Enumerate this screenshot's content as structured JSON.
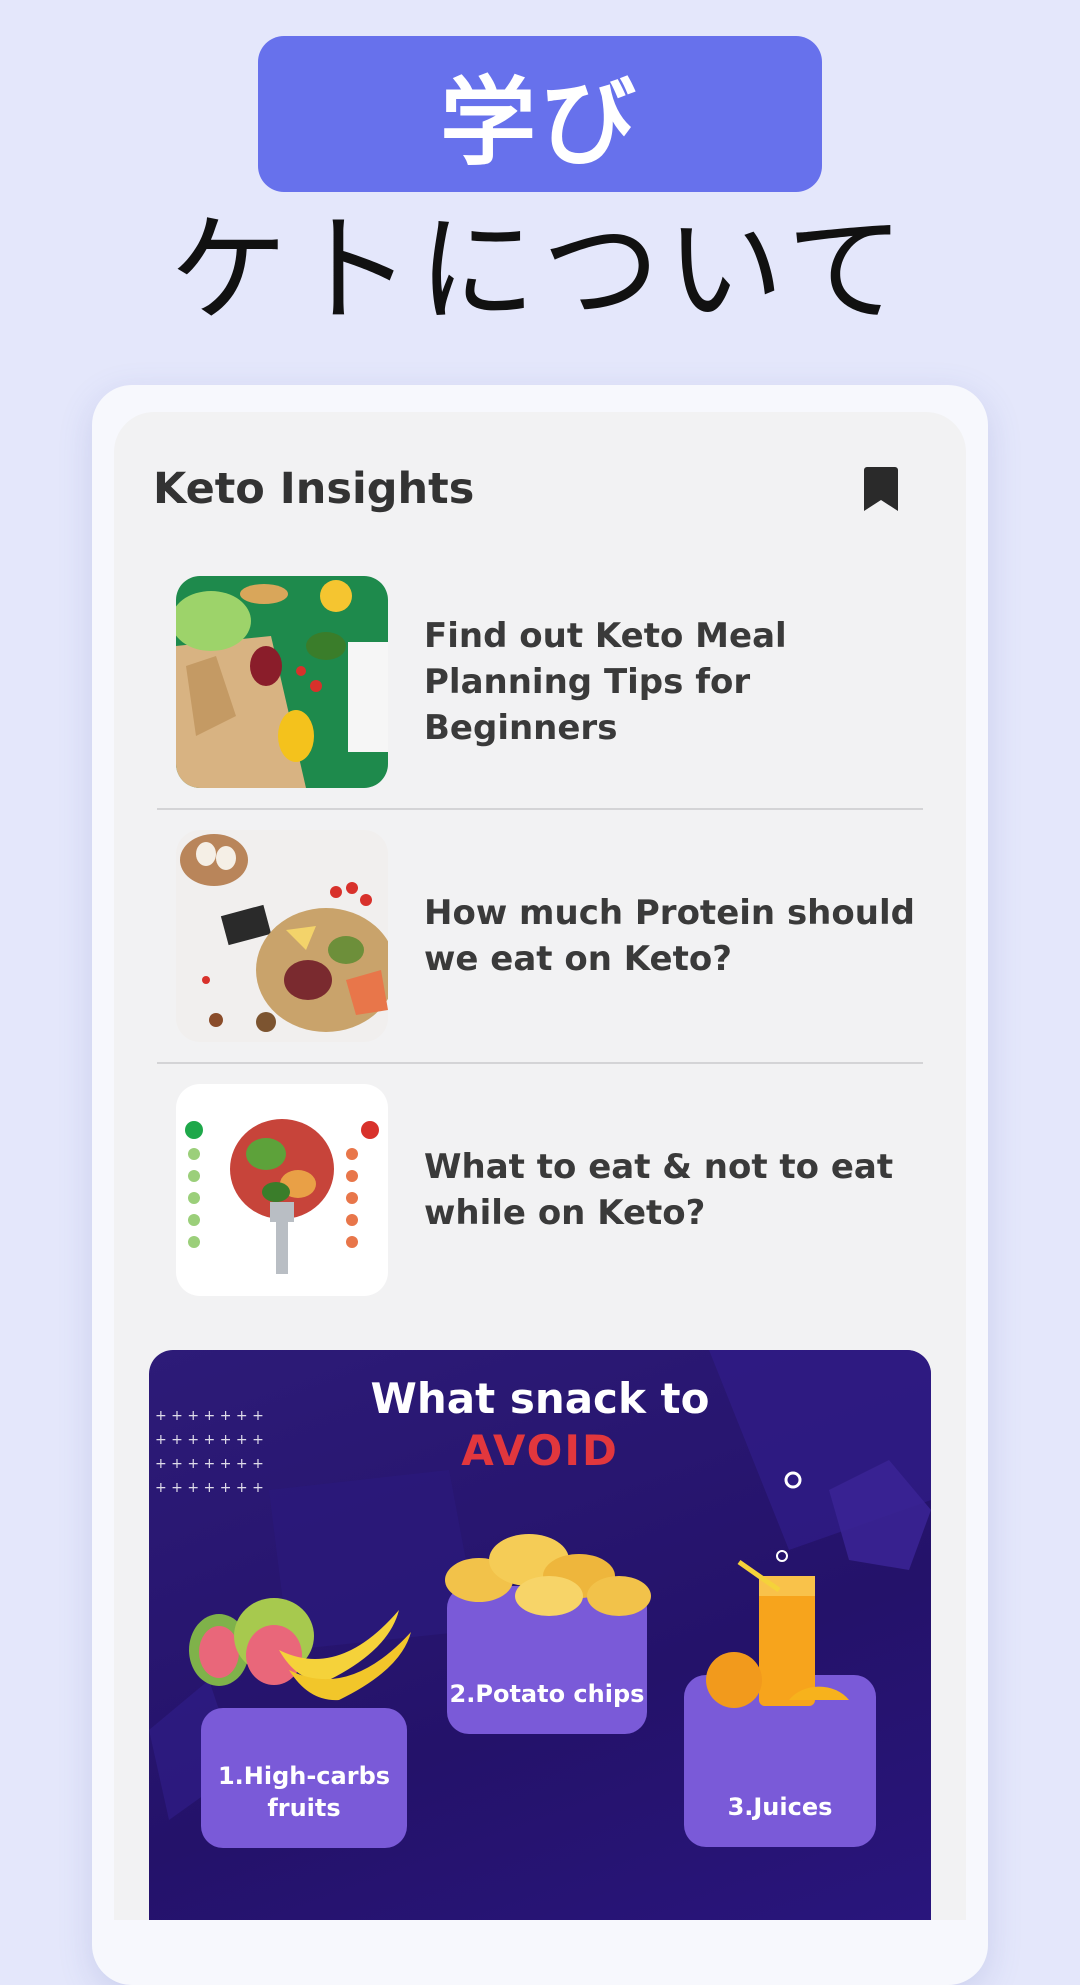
{
  "header": {
    "badge": "学び",
    "headline": "ケトについて"
  },
  "screen": {
    "title": "Keto Insights",
    "bookmark_icon": "bookmark-icon",
    "articles": [
      {
        "title": "Find out Keto Meal Planning Tips for Beginners",
        "image": "grocery-bag-vegetables-image"
      },
      {
        "title": "How much Protein should we eat on Keto?",
        "image": "protein-foods-image"
      },
      {
        "title": "What to eat & not to eat while on Keto?",
        "image": "keto-yes-no-chart-image"
      }
    ],
    "banner": {
      "title": "What snack to",
      "highlight": "AVOID",
      "items": [
        {
          "label": "1.High-carbs fruits"
        },
        {
          "label": "2.Potato chips"
        },
        {
          "label": "3.Juices"
        }
      ]
    }
  },
  "colors": {
    "background": "#e4e7fb",
    "badge": "#6771ec",
    "banner": "#24126a",
    "snack_card": "#7a5ad8",
    "avoid": "#e2373d"
  }
}
